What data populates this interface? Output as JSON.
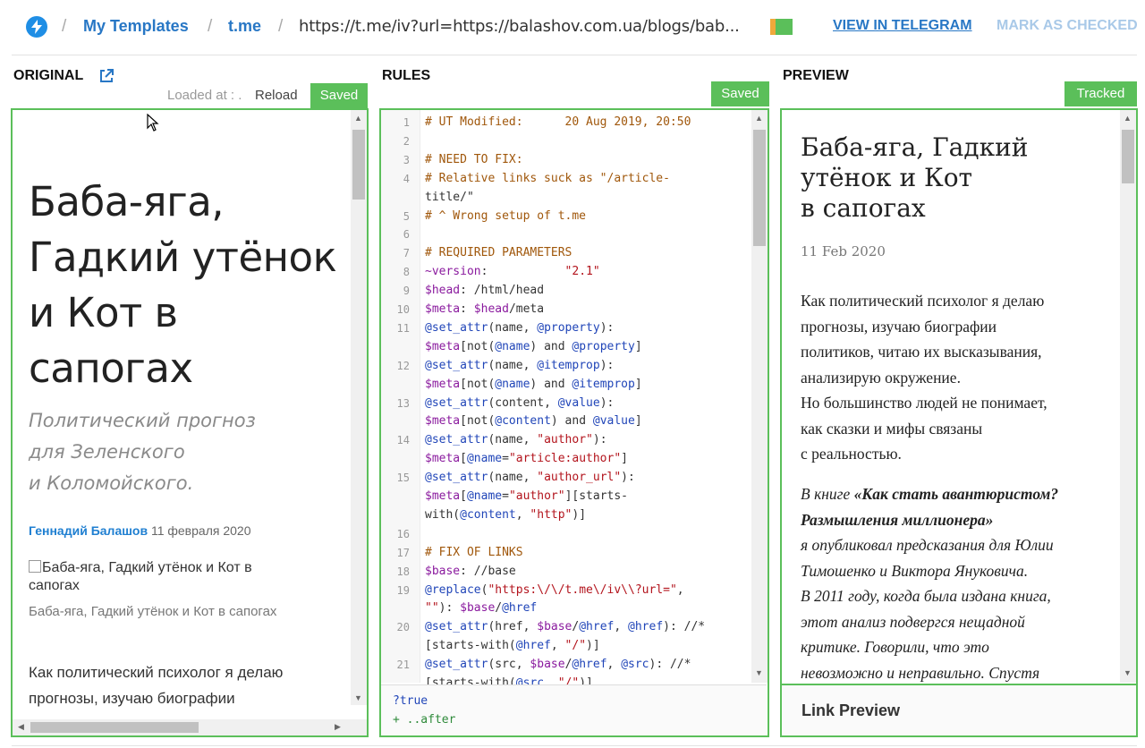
{
  "topbar": {
    "crumb_templates": "My Templates",
    "crumb_site": "t.me",
    "separator": "/",
    "url": "https://t.me/iv?url=https://balashov.com.ua/blogs/bab...",
    "view_in_telegram": "VIEW IN TELEGRAM",
    "mark_as_checked": "MARK AS CHECKED"
  },
  "original": {
    "heading": "ORIGINAL",
    "loaded_at": "Loaded at : .",
    "reload": "Reload",
    "badge": "Saved",
    "title": "Баба-яга, Гадкий утёнок и Кот в сапогах",
    "subtitle_lines": [
      "Политический прогноз",
      "для Зеленского",
      "и Коломойского."
    ],
    "author": "Геннадий Балашов",
    "date": "11 февраля 2020",
    "image_alt": "Баба-яга, Гадкий утёнок и Кот в сапогах",
    "image_caption": "Баба-яга, Гадкий утёнок и Кот в сапогах",
    "paragraph": "Как политический психолог я делаю прогнозы, изучаю биографии"
  },
  "rules": {
    "heading": "RULES",
    "badge": "Saved",
    "lines": [
      {
        "n": "1",
        "text": "# UT Modified:      20 Aug 2019, 20:50"
      },
      {
        "n": "2",
        "text": ""
      },
      {
        "n": "3",
        "text": "# NEED TO FIX:"
      },
      {
        "n": "4",
        "text": "# Relative links suck as \"/article-"
      },
      {
        "n": "",
        "text": "title/\""
      },
      {
        "n": "5",
        "text": "# ^ Wrong setup of t.me"
      },
      {
        "n": "6",
        "text": ""
      },
      {
        "n": "7",
        "text": "# REQUIRED PARAMETERS"
      },
      {
        "n": "8",
        "text": "~version:           \"2.1\""
      },
      {
        "n": "9",
        "text": "$head: /html/head"
      },
      {
        "n": "10",
        "text": "$meta: $head/meta"
      },
      {
        "n": "11",
        "text": "@set_attr(name, @property):"
      },
      {
        "n": "",
        "text": "$meta[not(@name) and @property]"
      },
      {
        "n": "12",
        "text": "@set_attr(name, @itemprop):"
      },
      {
        "n": "",
        "text": "$meta[not(@name) and @itemprop]"
      },
      {
        "n": "13",
        "text": "@set_attr(content, @value):"
      },
      {
        "n": "",
        "text": "$meta[not(@content) and @value]"
      },
      {
        "n": "14",
        "text": "@set_attr(name, \"author\"):"
      },
      {
        "n": "",
        "text": "$meta[@name=\"article:author\"]"
      },
      {
        "n": "15",
        "text": "@set_attr(name, \"author_url\"):"
      },
      {
        "n": "",
        "text": "$meta[@name=\"author\"][starts-"
      },
      {
        "n": "",
        "text": "with(@content, \"http\")]"
      },
      {
        "n": "16",
        "text": ""
      },
      {
        "n": "17",
        "text": "# FIX OF LINKS"
      },
      {
        "n": "18",
        "text": "$base: //base"
      },
      {
        "n": "19",
        "text": "@replace(\"https:\\/\\/t.me\\/iv\\\\?url=\","
      },
      {
        "n": "",
        "text": "\"\"): $base/@href"
      },
      {
        "n": "20",
        "text": "@set_attr(href, $base/@href, @href): //*"
      },
      {
        "n": "",
        "text": "[starts-with(@href, \"/\")]"
      },
      {
        "n": "21",
        "text": "@set_attr(src, $base/@href, @src): //*"
      },
      {
        "n": "",
        "text": "[starts-with(@src, \"/\")]"
      }
    ],
    "footer_line1": "?true",
    "footer_line2": "+ ..after"
  },
  "preview": {
    "heading": "PREVIEW",
    "badge": "Tracked",
    "title_lines": [
      "Баба-яга, Гадкий",
      "утёнок и Кот",
      "в сапогах"
    ],
    "date": "11 Feb 2020",
    "para1_lines": [
      "Как политический психолог я делаю",
      "прогнозы, изучаю биографии",
      "политиков, читаю их высказывания,",
      "анализирую окружение.",
      "Но большинство людей не понимает,",
      "как сказки и мифы связаны",
      "с реальностью."
    ],
    "para2_prefix": "В книге ",
    "para2_bold_1": "«Как стать авантюристом?",
    "para2_bold_2": "Размышления миллионера»",
    "para2_lines": [
      "я опубликовал предсказания для Юлии",
      "Тимошенко и Виктора Януковича.",
      "В 2011 году, когда была издана книга,",
      "этот анализ подвергся нещадной",
      "критике. Говорили, что это",
      "невозможно и неправильно. Спустя"
    ],
    "link_preview": "Link Preview"
  },
  "colors": {
    "accent_green": "#5bbf5a",
    "link_blue": "#2877c5",
    "muted_blue": "#a9c9e8",
    "logo_blue": "#1f8ee5"
  },
  "icons": [
    "bolt-icon",
    "external-link-icon",
    "cursor-arrow-icon",
    "scroll-up-arrow",
    "scroll-down-arrow"
  ]
}
